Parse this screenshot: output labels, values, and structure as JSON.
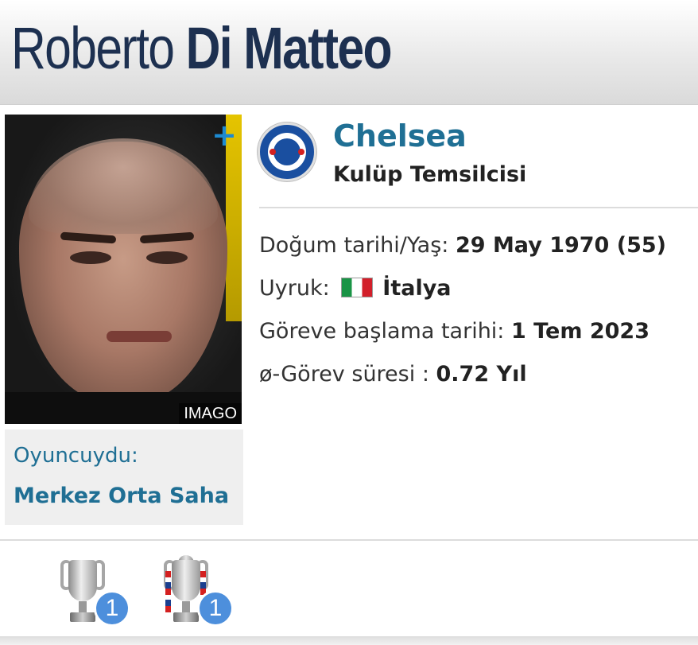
{
  "header": {
    "first_name": "Roberto",
    "last_name": "Di Matteo"
  },
  "photo": {
    "credit": "IMAGO",
    "add_icon": "plus-icon"
  },
  "former": {
    "label": "Oyuncuydu:",
    "position": "Merkez Orta Saha"
  },
  "club": {
    "name": "Chelsea",
    "role": "Kulüp Temsilcisi",
    "crest_icon": "chelsea-crest-icon"
  },
  "info": {
    "birth_label": "Doğum tarihi/Yaş:",
    "birth_value": "29 May 1970 (55)",
    "nationality_label": "Uyruk:",
    "nationality_value": "İtalya",
    "start_label": "Göreve başlama tarihi:",
    "start_value": "1 Tem 2023",
    "tenure_label": "ø-Görev süresi :",
    "tenure_value": "0.72 Yıl"
  },
  "trophies": [
    {
      "icon": "champions-league-trophy-icon",
      "count": "1"
    },
    {
      "icon": "fa-cup-trophy-icon",
      "count": "1"
    }
  ],
  "colors": {
    "title": "#1d3050",
    "link": "#1f6f94",
    "badge": "#4d8fdc",
    "plus": "#1d8ad1"
  }
}
